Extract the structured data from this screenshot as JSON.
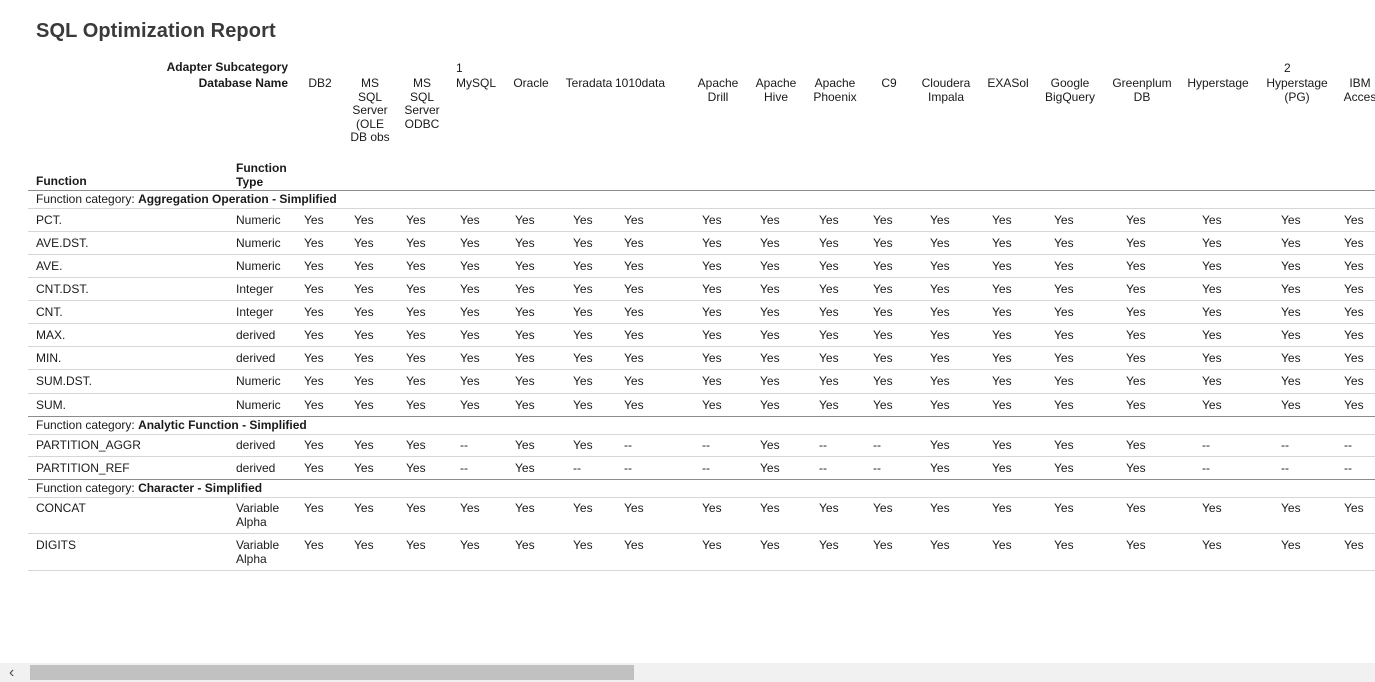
{
  "report": {
    "title": "SQL Optimization Report",
    "adapter_subcategory_label": "Adapter Subcategory",
    "database_name_label": "Database Name",
    "function_label": "Function",
    "function_type_label": "Function Type",
    "category_prefix": "Function category:"
  },
  "subcategory_marks": [
    "1",
    "2"
  ],
  "columns": [
    "DB2",
    "MS SQL Server (OLE DB obs",
    "MS SQL Server ODBC",
    "MySQL",
    "Oracle",
    "Teradata",
    "1010data",
    "Apache Drill",
    "Apache Hive",
    "Apache Phoenix",
    "C9",
    "Cloudera Impala",
    "EXASol",
    "Google BigQuery",
    "Greenplum DB",
    "Hyperstage",
    "Hyperstage (PG)",
    "IBM Acces"
  ],
  "categories": [
    {
      "name": "Aggregation Operation - Simplified",
      "rows": [
        {
          "function": "PCT.",
          "type": "Numeric",
          "values": [
            "Yes",
            "Yes",
            "Yes",
            "Yes",
            "Yes",
            "Yes",
            "Yes",
            "Yes",
            "Yes",
            "Yes",
            "Yes",
            "Yes",
            "Yes",
            "Yes",
            "Yes",
            "Yes",
            "Yes",
            "Yes"
          ]
        },
        {
          "function": "AVE.DST.",
          "type": "Numeric",
          "values": [
            "Yes",
            "Yes",
            "Yes",
            "Yes",
            "Yes",
            "Yes",
            "Yes",
            "Yes",
            "Yes",
            "Yes",
            "Yes",
            "Yes",
            "Yes",
            "Yes",
            "Yes",
            "Yes",
            "Yes",
            "Yes"
          ]
        },
        {
          "function": "AVE.",
          "type": "Numeric",
          "values": [
            "Yes",
            "Yes",
            "Yes",
            "Yes",
            "Yes",
            "Yes",
            "Yes",
            "Yes",
            "Yes",
            "Yes",
            "Yes",
            "Yes",
            "Yes",
            "Yes",
            "Yes",
            "Yes",
            "Yes",
            "Yes"
          ]
        },
        {
          "function": "CNT.DST.",
          "type": "Integer",
          "values": [
            "Yes",
            "Yes",
            "Yes",
            "Yes",
            "Yes",
            "Yes",
            "Yes",
            "Yes",
            "Yes",
            "Yes",
            "Yes",
            "Yes",
            "Yes",
            "Yes",
            "Yes",
            "Yes",
            "Yes",
            "Yes"
          ]
        },
        {
          "function": "CNT.",
          "type": "Integer",
          "values": [
            "Yes",
            "Yes",
            "Yes",
            "Yes",
            "Yes",
            "Yes",
            "Yes",
            "Yes",
            "Yes",
            "Yes",
            "Yes",
            "Yes",
            "Yes",
            "Yes",
            "Yes",
            "Yes",
            "Yes",
            "Yes"
          ]
        },
        {
          "function": "MAX.",
          "type": "derived",
          "values": [
            "Yes",
            "Yes",
            "Yes",
            "Yes",
            "Yes",
            "Yes",
            "Yes",
            "Yes",
            "Yes",
            "Yes",
            "Yes",
            "Yes",
            "Yes",
            "Yes",
            "Yes",
            "Yes",
            "Yes",
            "Yes"
          ]
        },
        {
          "function": "MIN.",
          "type": "derived",
          "values": [
            "Yes",
            "Yes",
            "Yes",
            "Yes",
            "Yes",
            "Yes",
            "Yes",
            "Yes",
            "Yes",
            "Yes",
            "Yes",
            "Yes",
            "Yes",
            "Yes",
            "Yes",
            "Yes",
            "Yes",
            "Yes"
          ]
        },
        {
          "function": "SUM.DST.",
          "type": "Numeric",
          "values": [
            "Yes",
            "Yes",
            "Yes",
            "Yes",
            "Yes",
            "Yes",
            "Yes",
            "Yes",
            "Yes",
            "Yes",
            "Yes",
            "Yes",
            "Yes",
            "Yes",
            "Yes",
            "Yes",
            "Yes",
            "Yes"
          ]
        },
        {
          "function": "SUM.",
          "type": "Numeric",
          "values": [
            "Yes",
            "Yes",
            "Yes",
            "Yes",
            "Yes",
            "Yes",
            "Yes",
            "Yes",
            "Yes",
            "Yes",
            "Yes",
            "Yes",
            "Yes",
            "Yes",
            "Yes",
            "Yes",
            "Yes",
            "Yes"
          ]
        }
      ]
    },
    {
      "name": "Analytic Function - Simplified",
      "rows": [
        {
          "function": "PARTITION_AGGR",
          "type": "derived",
          "values": [
            "Yes",
            "Yes",
            "Yes",
            "--",
            "Yes",
            "Yes",
            "--",
            "--",
            "Yes",
            "--",
            "--",
            "Yes",
            "Yes",
            "Yes",
            "Yes",
            "--",
            "--",
            "--"
          ]
        },
        {
          "function": "PARTITION_REF",
          "type": "derived",
          "values": [
            "Yes",
            "Yes",
            "Yes",
            "--",
            "Yes",
            "--",
            "--",
            "--",
            "Yes",
            "--",
            "--",
            "Yes",
            "Yes",
            "Yes",
            "Yes",
            "--",
            "--",
            "--"
          ]
        }
      ]
    },
    {
      "name": "Character - Simplified",
      "rows": [
        {
          "function": "CONCAT",
          "type": "Variable Alpha",
          "values": [
            "Yes",
            "Yes",
            "Yes",
            "Yes",
            "Yes",
            "Yes",
            "Yes",
            "Yes",
            "Yes",
            "Yes",
            "Yes",
            "Yes",
            "Yes",
            "Yes",
            "Yes",
            "Yes",
            "Yes",
            "Yes"
          ]
        },
        {
          "function": "DIGITS",
          "type": "Variable Alpha",
          "values": [
            "Yes",
            "Yes",
            "Yes",
            "Yes",
            "Yes",
            "Yes",
            "Yes",
            "Yes",
            "Yes",
            "Yes",
            "Yes",
            "Yes",
            "Yes",
            "Yes",
            "Yes",
            "Yes",
            "Yes",
            "Yes"
          ]
        }
      ]
    }
  ],
  "scrollbar": {
    "left_arrow": "‹"
  }
}
